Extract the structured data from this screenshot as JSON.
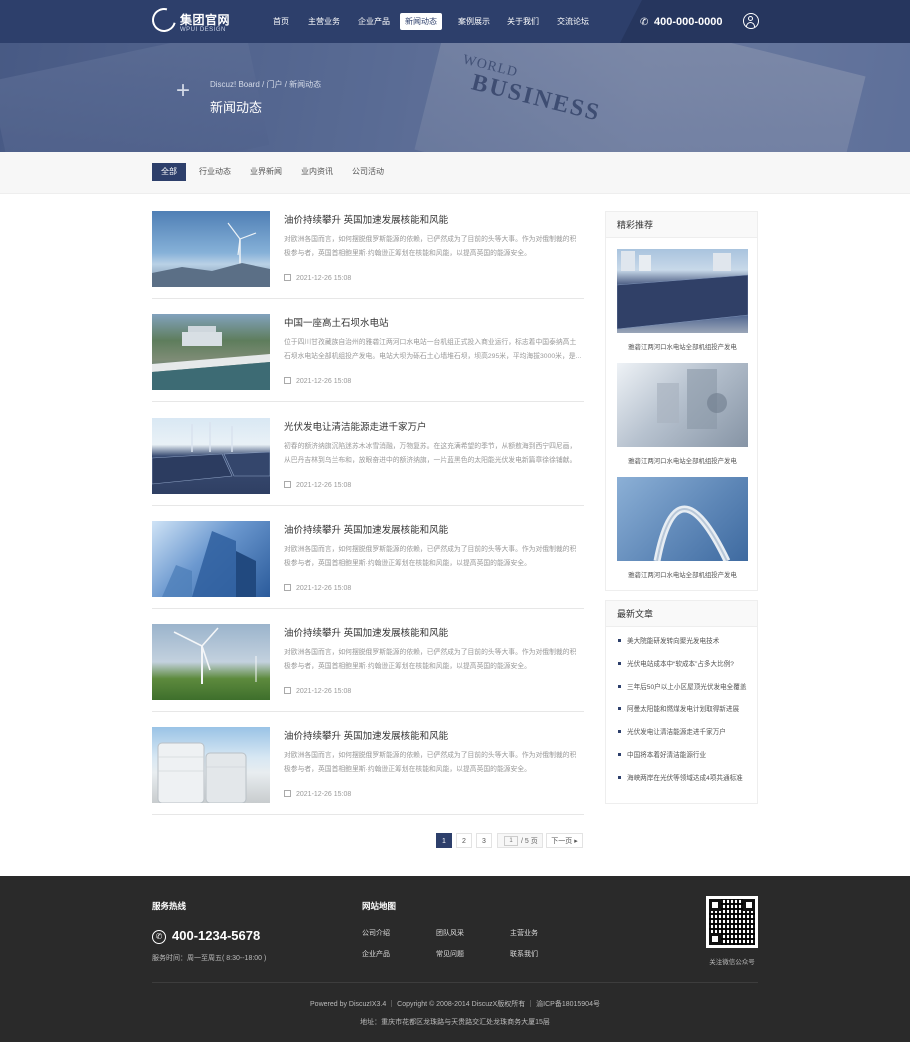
{
  "header": {
    "logo_title": "集团官网",
    "logo_subtitle": "WPUI DESIGN",
    "nav": [
      "首页",
      "主营业务",
      "企业产品",
      "新闻动态",
      "案例展示",
      "关于我们",
      "交流论坛"
    ],
    "active_nav": "新闻动态",
    "phone": "400-000-0000",
    "phone_icon": "phone-icon",
    "user_icon": "user-icon"
  },
  "banner": {
    "breadcrumb": [
      "Discuz! Board",
      "门户",
      "新闻动态"
    ],
    "title": "新闻动态"
  },
  "tabs": [
    "全部",
    "行业动态",
    "业界新闻",
    "业内资讯",
    "公司活动"
  ],
  "active_tab": "全部",
  "articles": [
    {
      "title": "油价持续攀升 英国加速发展核能和风能",
      "summary": "对欧洲各国而言，如何摆脱俄罗斯能源的依赖，已俨然成为了目前的头等大事。作为对俄制裁的积极参与者，英国首相鲍里斯·约翰逊正筹划在核能和风能，以提高英国的能源安全。",
      "date": "2021-12-26 15:08"
    },
    {
      "title": "中国一座高土石坝水电站",
      "summary": "位于四川甘孜藏族自治州的雅砻江两河口水电站一台机组正式投入商业运行，标志着中国泰纳高土石坝水电站全部机组投产发电。电站大坝为砾石土心墙堆石坝，坝高295米，平均海拔3000米，是...",
      "date": "2021-12-26 15:08"
    },
    {
      "title": "光伏发电让清洁能源走进千家万户",
      "summary": "初春的额济纳旗沉陷迷苏木冰雪消融，万物复苏。在这充满希望的季节，从额敖海到西宁四尼画，从巴丹吉林到乌兰布和，放眼奋进中的额济纳旗，一片蓝黑色的太阳能光伏发电新篇章徐徐铺献。",
      "date": "2021-12-26 15:08"
    },
    {
      "title": "油价持续攀升 英国加速发展核能和风能",
      "summary": "对欧洲各国而言，如何摆脱俄罗斯能源的依赖，已俨然成为了目前的头等大事。作为对俄制裁的积极参与者，英国首相鲍里斯·约翰逊正筹划在核能和风能，以提高英国的能源安全。",
      "date": "2021-12-26 15:08"
    },
    {
      "title": "油价持续攀升 英国加速发展核能和风能",
      "summary": "对欧洲各国而言，如何摆脱俄罗斯能源的依赖，已俨然成为了目前的头等大事。作为对俄制裁的积极参与者，英国首相鲍里斯·约翰逊正筹划在核能和风能，以提高英国的能源安全。",
      "date": "2021-12-26 15:08"
    },
    {
      "title": "油价持续攀升 英国加速发展核能和风能",
      "summary": "对欧洲各国而言，如何摆脱俄罗斯能源的依赖，已俨然成为了目前的头等大事。作为对俄制裁的积极参与者，英国首相鲍里斯·约翰逊正筹划在核能和风能，以提高英国的能源安全。",
      "date": "2021-12-26 15:08"
    }
  ],
  "pagination": {
    "pages": [
      "1",
      "2",
      "3"
    ],
    "current": "1",
    "input": "1",
    "total": "/ 5 页",
    "next": "下一页"
  },
  "sidebar": {
    "featured_title": "精彩推荐",
    "featured": [
      {
        "caption": "雅砻江两河口水电站全部机组投产发电"
      },
      {
        "caption": "雅砻江两河口水电站全部机组投产发电"
      },
      {
        "caption": "雅砻江两河口水电站全部机组投产发电"
      }
    ],
    "latest_title": "最新文章",
    "latest": [
      "美大院能研发转向聚光发电技术",
      "光伏电站成本中“软成本”占多大比例?",
      "三年后50户以上小区屋顶光伏发电全覆盖",
      "阿曼太阳能和燃煤发电计划取得新进展",
      "光伏发电让清洁能源走进千家万户",
      "中国将本着好清洁能源行业",
      "海峡两岸在光伏等领域达成4项共通标准"
    ]
  },
  "footer": {
    "hotline_title": "服务热线",
    "hotline": "400-1234-5678",
    "service_hours": "服务时间：周一至周五( 8:30--18:00 )",
    "sitemap_title": "网站地图",
    "links": [
      "公司介绍",
      "团队风采",
      "主营业务",
      "企业产品",
      "常见问题",
      "联系我们"
    ],
    "qr_caption": "关注微信公众号",
    "copyright": "Powered by DiscuzIX3.4 ｜ Copyright © 2008-2014 DiscuzX版权所有 ｜ 渝ICP备18015904号",
    "address": "地址：重庆市花都区龙珠路与天贵路交汇处龙珠商务大厦15层"
  }
}
